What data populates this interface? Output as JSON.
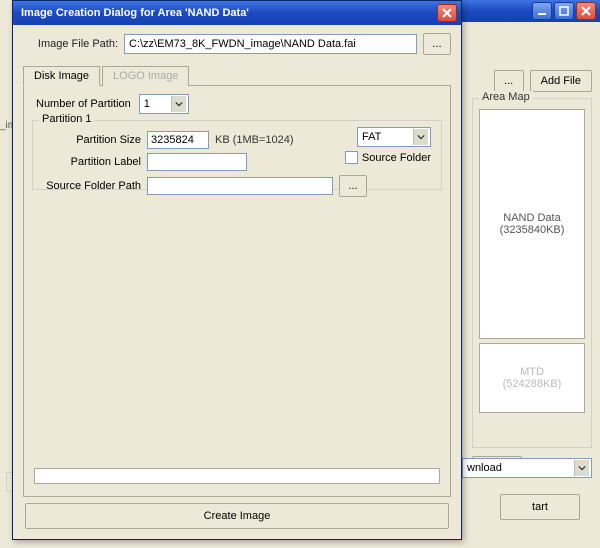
{
  "parent": {
    "min_icon": "minimize-icon",
    "max_icon": "maximize-icon",
    "close_icon": "close-icon",
    "ellipsis": "...",
    "add_file": "Add File",
    "area_map_label": "Area Map",
    "area_nand_name": "NAND Data",
    "area_nand_size": "(3235840KB)",
    "area_mtd_name": "MTD",
    "area_mtd_size": "(524288KB)",
    "bottom_ellipsis": "...",
    "download_label": "wnload",
    "start_label": "tart",
    "left_strip": "_ima"
  },
  "dialog": {
    "title": "Image Creation Dialog for Area 'NAND Data'",
    "close_icon": "close-icon",
    "file_path_label": "Image File Path:",
    "file_path_value": "C:\\zz\\EM73_8K_FWDN_image\\NAND Data.fai",
    "browse_ellipsis": "...",
    "tabs": {
      "disk": "Disk Image",
      "logo": "LOGO Image"
    },
    "num_partition_label": "Number of Partition",
    "num_partition_value": "1",
    "partition_group_label": "Partition 1",
    "partition_size_label": "Partition Size",
    "partition_size_value": "3235824",
    "partition_size_unit": "KB (1MB=1024)",
    "partition_label_label": "Partition Label",
    "partition_label_value": "",
    "source_folder_label": "Source Folder Path",
    "source_folder_value": "",
    "source_folder_ellipsis": "...",
    "filesystem_value": "FAT",
    "source_folder_checkbox": "Source Folder",
    "create_button": "Create Image"
  }
}
